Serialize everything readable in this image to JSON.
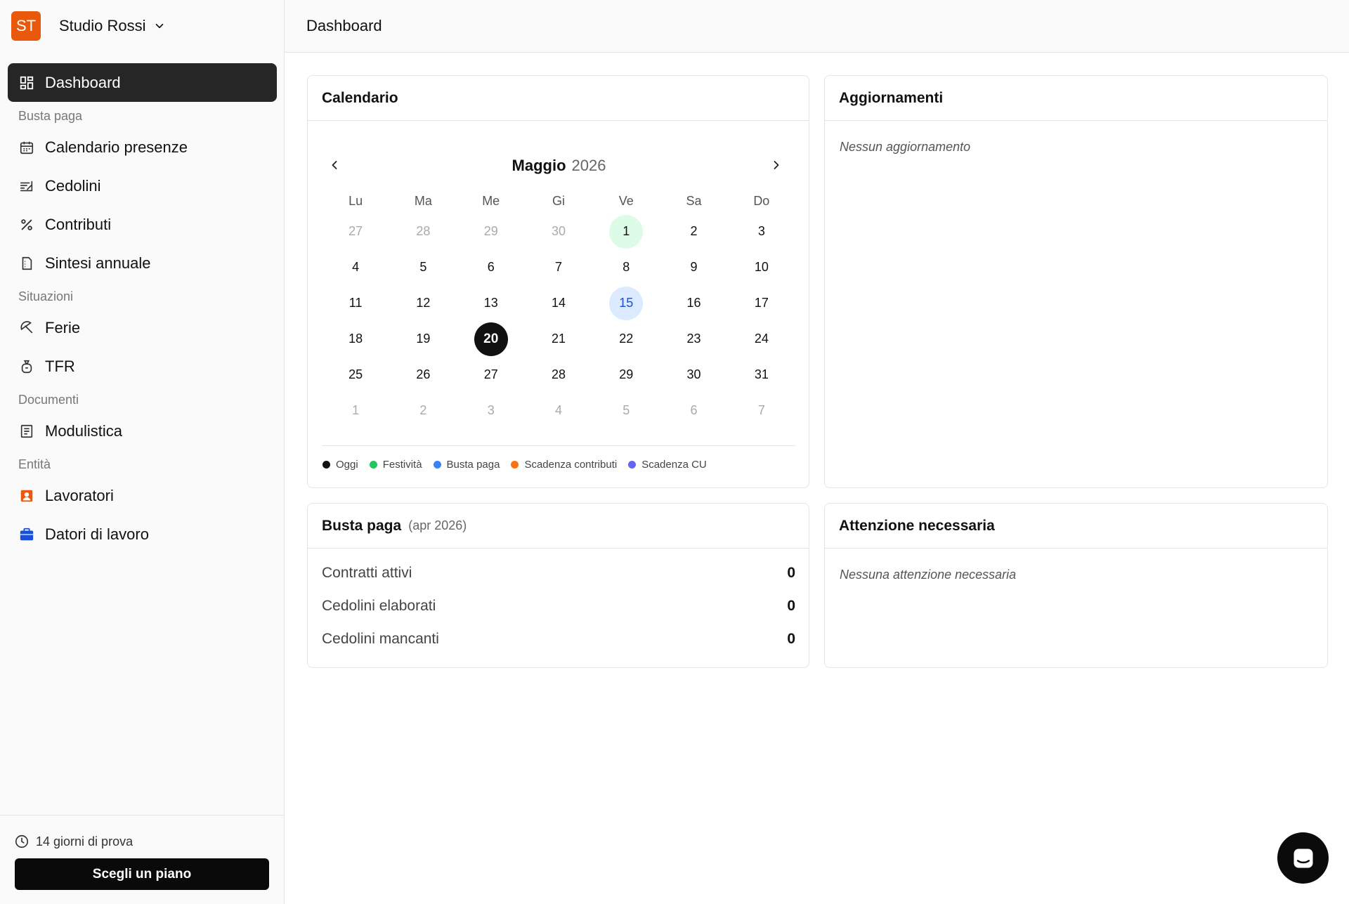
{
  "org": {
    "initials": "ST",
    "name": "Studio Rossi"
  },
  "header": {
    "title": "Dashboard"
  },
  "nav": {
    "dashboard": "Dashboard",
    "sections": {
      "busta_paga": "Busta paga",
      "situazioni": "Situazioni",
      "documenti": "Documenti",
      "entita": "Entità"
    },
    "items": {
      "calendario_presenze": "Calendario presenze",
      "cedolini": "Cedolini",
      "contributi": "Contributi",
      "sintesi_annuale": "Sintesi annuale",
      "ferie": "Ferie",
      "tfr": "TFR",
      "modulistica": "Modulistica",
      "lavoratori": "Lavoratori",
      "datori_di_lavoro": "Datori di lavoro"
    }
  },
  "sidebar_bottom": {
    "trial": "14 giorni di prova",
    "plan_button": "Scegli un piano"
  },
  "calendar": {
    "title": "Calendario",
    "month": "Maggio",
    "year": "2026",
    "weekdays": [
      "Lu",
      "Ma",
      "Me",
      "Gi",
      "Ve",
      "Sa",
      "Do"
    ],
    "weeks": [
      [
        "27",
        "28",
        "29",
        "30",
        "1",
        "2",
        "3"
      ],
      [
        "4",
        "5",
        "6",
        "7",
        "8",
        "9",
        "10"
      ],
      [
        "11",
        "12",
        "13",
        "14",
        "15",
        "16",
        "17"
      ],
      [
        "18",
        "19",
        "20",
        "21",
        "22",
        "23",
        "24"
      ],
      [
        "25",
        "26",
        "27",
        "28",
        "29",
        "30",
        "31"
      ],
      [
        "1",
        "2",
        "3",
        "4",
        "5",
        "6",
        "7"
      ]
    ],
    "legend": [
      {
        "label": "Oggi",
        "color": "#111111"
      },
      {
        "label": "Festività",
        "color": "#22c55e"
      },
      {
        "label": "Busta paga",
        "color": "#3b82f6"
      },
      {
        "label": "Scadenza contributi",
        "color": "#f97316"
      },
      {
        "label": "Scadenza CU",
        "color": "#6366f1"
      }
    ]
  },
  "updates": {
    "title": "Aggiornamenti",
    "empty": "Nessun aggiornamento"
  },
  "payroll": {
    "title": "Busta paga",
    "period": "(apr 2026)",
    "stats": [
      {
        "label": "Contratti attivi",
        "value": "0"
      },
      {
        "label": "Cedolini elaborati",
        "value": "0"
      },
      {
        "label": "Cedolini mancanti",
        "value": "0"
      }
    ]
  },
  "attention": {
    "title": "Attenzione necessaria",
    "empty": "Nessuna attenzione necessaria"
  },
  "colors": {
    "accent": "#ea580c",
    "active_nav": "#262626",
    "today": "#111111",
    "holiday_bg": "#dcfce7",
    "payday_bg": "#dbeafe"
  }
}
